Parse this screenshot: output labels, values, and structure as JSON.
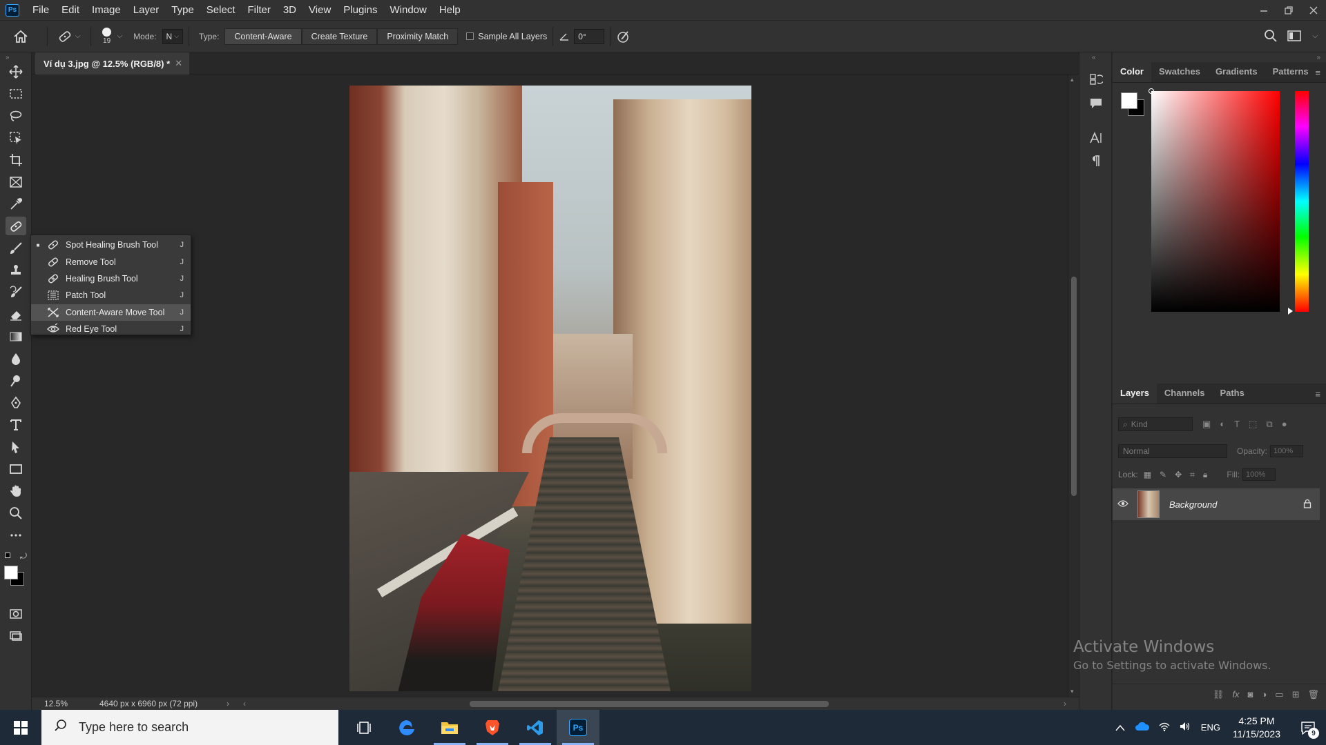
{
  "menu": [
    "File",
    "Edit",
    "Image",
    "Layer",
    "Type",
    "Select",
    "Filter",
    "3D",
    "View",
    "Plugins",
    "Window",
    "Help"
  ],
  "app_logo": "Ps",
  "options": {
    "brush_size": "19",
    "mode_label": "Mode:",
    "mode_value": "N",
    "type_label": "Type:",
    "type_buttons": [
      "Content-Aware",
      "Create Texture",
      "Proximity Match"
    ],
    "sample_all_layers": "Sample All Layers",
    "angle_value": "0°"
  },
  "document": {
    "tab_title": "Ví dụ 3.jpg @ 12.5% (RGB/8) *",
    "zoom": "12.5%",
    "doc_size": "4640 px x 6960 px (72 ppi)"
  },
  "flyout": {
    "items": [
      {
        "label": "Spot Healing Brush Tool",
        "key": "J",
        "icon": "spot-healing-brush-icon",
        "selected": true
      },
      {
        "label": "Remove Tool",
        "key": "J",
        "icon": "remove-tool-icon"
      },
      {
        "label": "Healing Brush Tool",
        "key": "J",
        "icon": "healing-brush-icon"
      },
      {
        "label": "Patch Tool",
        "key": "J",
        "icon": "patch-tool-icon"
      },
      {
        "label": "Content-Aware Move Tool",
        "key": "J",
        "icon": "content-aware-move-icon",
        "hovered": true
      },
      {
        "label": "Red Eye Tool",
        "key": "J",
        "icon": "red-eye-icon"
      }
    ]
  },
  "color_panel": {
    "tabs": [
      "Color",
      "Swatches",
      "Gradients",
      "Patterns"
    ],
    "foreground": "#ffffff",
    "background": "#000000",
    "hue": "#ff0000"
  },
  "layers_panel": {
    "tabs": [
      "Layers",
      "Channels",
      "Paths"
    ],
    "kind_placeholder": "Kind",
    "blend_mode": "Normal",
    "opacity_label": "Opacity:",
    "opacity_value": "100%",
    "lock_label": "Lock:",
    "fill_label": "Fill:",
    "fill_value": "100%",
    "layers": [
      {
        "name": "Background",
        "visible": true,
        "locked": true
      }
    ]
  },
  "watermark": {
    "line1": "Activate Windows",
    "line2": "Go to Settings to activate Windows."
  },
  "taskbar": {
    "search_placeholder": "Type here to search",
    "language": "ENG",
    "time": "4:25 PM",
    "date": "11/15/2023",
    "notification_count": "9"
  }
}
